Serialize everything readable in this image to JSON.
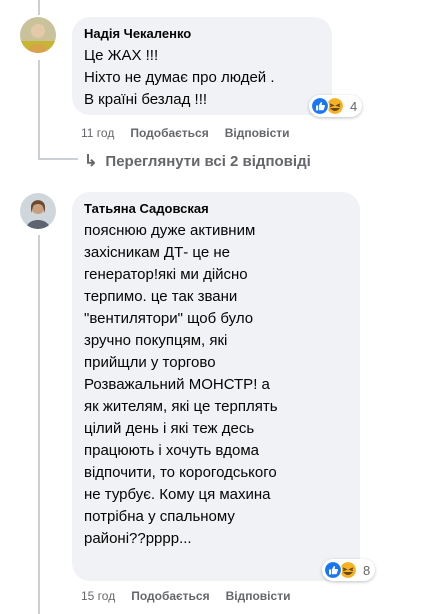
{
  "comments": [
    {
      "author": "Надія Чекаленко",
      "text": "Це ЖАХ !!!\nНіхто не думає про людей .\nВ країні безлад !!!",
      "reaction_count": "4",
      "time": "11 год",
      "like_label": "Подобається",
      "reply_label": "Відповісти"
    },
    {
      "author": "Татьяна Садовская",
      "text": "пояснюю дуже активним\nзахісникам ДТ- це не\nгенератор!які ми дійсно\nтерпимо. це так звани\n\"вентилятори\" щоб було\nзручно покупцям, які\nприйщли у торгово\nРозважальний МОНСТР! а\nяк жителям, які це терплять\nцілий день і які теж десь\nпрацюють і хочуть вдома\nвідпочити, то корогодського\nне турбує. Кому ця махина\nпотрібна у спальному\nрайоні??рррр...",
      "reaction_count": "8",
      "time": "15 год",
      "like_label": "Подобається",
      "reply_label": "Відповісти"
    }
  ],
  "view_replies": {
    "arrow": "↳",
    "label": "Переглянути всі 2 відповіді"
  },
  "reaction_icons": [
    "like-icon",
    "haha-icon"
  ],
  "colors": {
    "bubble": "#f0f2f5",
    "meta_text": "#65676b",
    "like_blue": "#1877f2",
    "haha_yellow": "#f7b125",
    "thread_line": "#ccd0d5"
  }
}
